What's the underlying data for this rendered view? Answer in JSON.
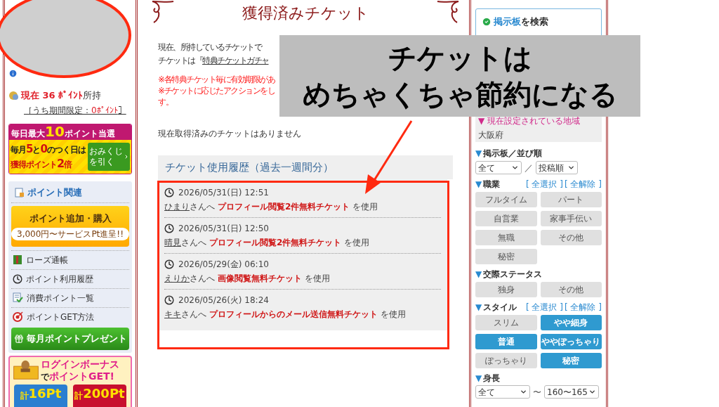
{
  "sidebar": {
    "points": {
      "current": "現在 36 ﾎﾟｲﾝﾄ",
      "suffix": "所持",
      "limited_prefix": "［うち期間限定：",
      "limited_value": "0ﾎﾟｲﾝﾄ",
      "limited_suffix": "］"
    },
    "lottery_banner": {
      "headline": [
        {
          "text": "毎日最大",
          "big": false
        },
        {
          "text": "10",
          "big": true
        },
        {
          "text": "ポイント当選",
          "big": false
        }
      ],
      "line1": [
        {
          "text": "毎月",
          "big": false
        },
        {
          "text": "5",
          "big": true
        },
        {
          "text": "と",
          "big": false
        },
        {
          "text": "0",
          "big": true
        },
        {
          "text": "のつく日は",
          "big": false
        }
      ],
      "line2": [
        {
          "text": "獲得ポイント",
          "big": false
        },
        {
          "text": "2",
          "big": true
        },
        {
          "text": "倍",
          "big": false
        }
      ],
      "button": "おみくじを引く"
    },
    "panel": {
      "title": "ポイント関連",
      "buy_button": {
        "label": "ポイント追加・購入",
        "note": "3,000円〜サービスPt進呈!!"
      },
      "items": [
        {
          "label": "ローズ通帳",
          "kind": "ledger"
        },
        {
          "label": "ポイント利用履歴",
          "kind": "clock"
        },
        {
          "label": "消費ポイント一覧",
          "kind": "checklist"
        },
        {
          "label": "ポイントGET方法",
          "kind": "target"
        }
      ],
      "present_button": "毎月ポイントプレゼント"
    },
    "login_banner": {
      "title": "ログインボーナス",
      "joiner": "で",
      "subtitle": "ポイントGET!",
      "tiles": [
        {
          "prefix": "計",
          "amount": "16Pt",
          "color": "#2a7fd0"
        },
        {
          "prefix": "計",
          "amount": "200Pt",
          "color": "#c8102e"
        }
      ]
    }
  },
  "main": {
    "title": "獲得済みチケット",
    "intro": "現在、所持しているチケットで",
    "intro2_prefix": "チケットは『",
    "intro2_link": "特典チケットガチャ",
    "notes": [
      "※各特典チケット毎に有効期限があ",
      "※チケットに応じたアクションをし",
      "す。"
    ],
    "empty_message": "現在取得済みのチケットはありません",
    "history": {
      "title": "チケット使用履歴（過去一週間分）",
      "entries": [
        {
          "time": "2026/05/31(日) 12:51",
          "name": "ひまり",
          "honorific": "さんへ",
          "ticket": "プロフィール閲覧2件無料チケット",
          "action": "を使用"
        },
        {
          "time": "2026/05/31(日) 12:50",
          "name": "晴見",
          "honorific": "さんへ",
          "ticket": "プロフィール閲覧2件無料チケット",
          "action": "を使用"
        },
        {
          "time": "2026/05/29(金) 06:10",
          "name": "えりか",
          "honorific": "さんへ",
          "ticket": "画像閲覧無料チケット",
          "action": "を使用"
        },
        {
          "time": "2026/05/26(火) 18:24",
          "name": "キキ",
          "honorific": "さんへ",
          "ticket": "プロフィールからのメール送信無料チケット",
          "action": "を使用"
        }
      ]
    }
  },
  "search": {
    "title_link": "掲示板",
    "title_suffix": "を検索",
    "region": {
      "marker": "▼",
      "label": "現在設定されている地域",
      "value": "大阪府"
    },
    "board": {
      "marker": "▼",
      "label": "掲示板／並び順",
      "select1": "全て",
      "separator": "／",
      "select2": "投稿順"
    },
    "groups": [
      {
        "marker": "▼",
        "label": "職業",
        "select_all": "[ 全選択 ]",
        "clear_all": "[ 全解除 ]",
        "options": [
          {
            "label": "フルタイム",
            "selected": false
          },
          {
            "label": "パート",
            "selected": false
          },
          {
            "label": "自営業",
            "selected": false
          },
          {
            "label": "家事手伝い",
            "selected": false
          },
          {
            "label": "無職",
            "selected": false
          },
          {
            "label": "その他",
            "selected": false
          },
          {
            "label": "秘密",
            "selected": false
          }
        ]
      },
      {
        "marker": "▼",
        "label": "交際ステータス",
        "options": [
          {
            "label": "独身",
            "selected": false
          },
          {
            "label": "その他",
            "selected": false
          }
        ]
      },
      {
        "marker": "▼",
        "label": "スタイル",
        "select_all": "[ 全選択 ]",
        "clear_all": "[ 全解除 ]",
        "options": [
          {
            "label": "スリム",
            "selected": false
          },
          {
            "label": "やや細身",
            "selected": true
          },
          {
            "label": "普通",
            "selected": true
          },
          {
            "label": "ややぽっちゃり",
            "selected": true
          },
          {
            "label": "ぽっちゃり",
            "selected": false
          },
          {
            "label": "秘密",
            "selected": true
          }
        ]
      }
    ],
    "height": {
      "marker": "▼",
      "label": "身長",
      "select1": "全て",
      "separator": "〜",
      "select2": "160〜165"
    }
  },
  "annotation": {
    "lines": [
      "チケットは",
      "めちゃくちゃ節約になる"
    ]
  }
}
